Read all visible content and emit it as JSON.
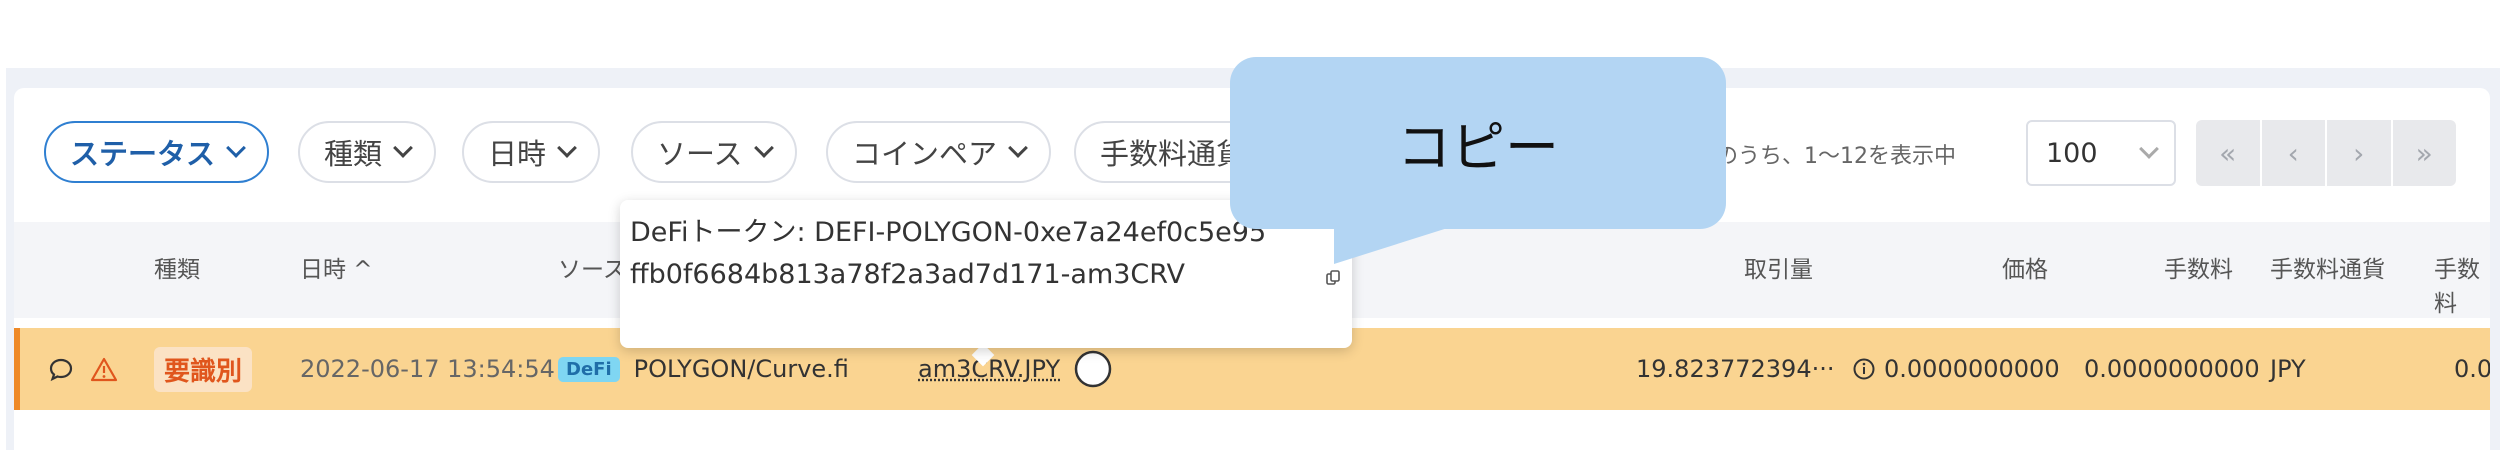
{
  "filters": [
    "ステータス",
    "種類",
    "日時",
    "ソース",
    "コインペア",
    "手数料通貨"
  ],
  "pagination": {
    "range_text": "件のうち、1〜12を表示中",
    "per_page": "100",
    "first": "«",
    "prev": "‹",
    "next": "›",
    "last": "»"
  },
  "columns": [
    "種類",
    "日時 ^",
    "ソース",
    "取引量",
    "価格",
    "手数料",
    "手数料通貨",
    "手数料"
  ],
  "row": {
    "status": "要識別",
    "datetime": "2022-06-17 13:54:54",
    "source_badge": "DeFi",
    "source": "POLYGON/Curve.fi",
    "pair": "am3CRV.JPY",
    "volume": "19.823772394···",
    "price": "0.0000000000",
    "fee": "0.0000000000",
    "fee_currency": "JPY",
    "fee_cut": "0.0"
  },
  "tooltip": {
    "text": "DeFiトークン: DEFI-POLYGON-0xe7a24ef0c5e95ffb0f6684b813a78f2a3ad7d171-am3CRV"
  },
  "callout": {
    "label": "コピー"
  },
  "colors": {
    "row_highlight": "#fad491",
    "accent": "#2f7fd1",
    "callout": "#b3d5f3",
    "warn": "#e0561d"
  }
}
